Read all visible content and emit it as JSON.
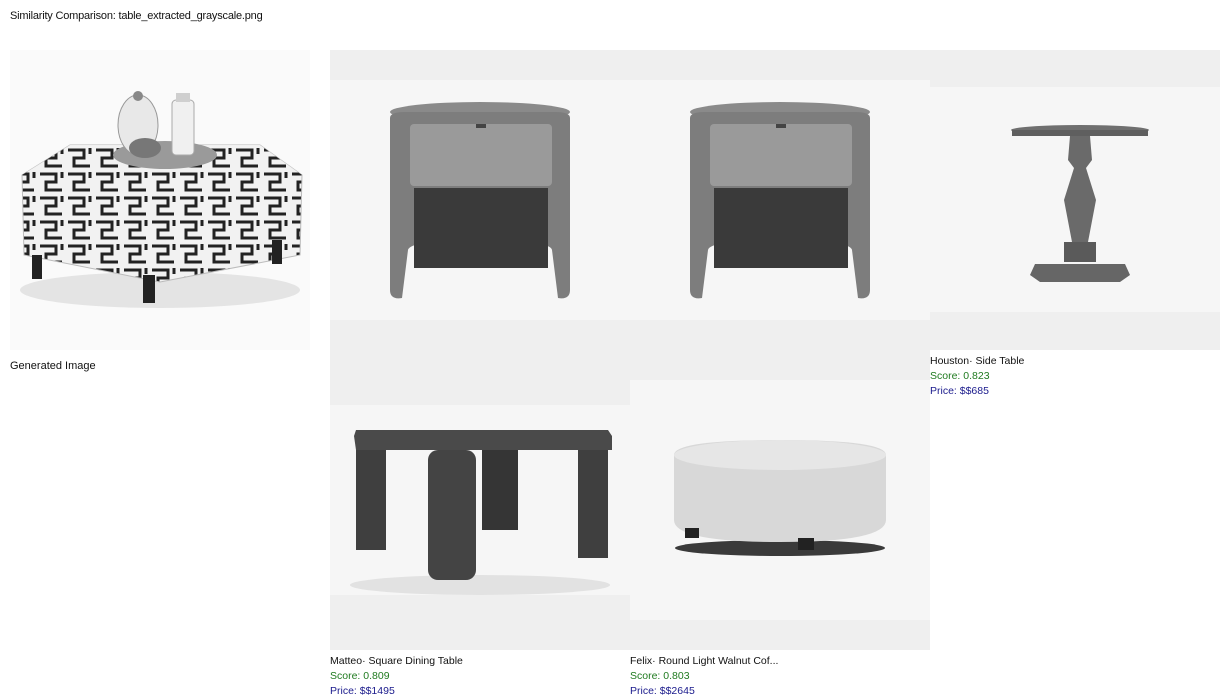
{
  "page": {
    "title": "Similarity Comparison: table_extracted_grayscale.png"
  },
  "generated": {
    "label": "Generated Image",
    "icon": "upholstered-ottoman-with-tray"
  },
  "results": [
    {
      "name": "",
      "score": "",
      "price": "",
      "icon": "round-nightstand"
    },
    {
      "name": "",
      "score": "",
      "price": "",
      "icon": "round-nightstand"
    },
    {
      "name": "Houston· Side Table",
      "score": "Score: 0.823",
      "price": "Price: $$685",
      "icon": "pedestal-side-table"
    },
    {
      "name": "Matteo· Square Dining Table",
      "score": "Score: 0.809",
      "price": "Price: $$1495",
      "icon": "square-dining-table"
    },
    {
      "name": "Felix· Round Light Walnut Cof...",
      "score": "Score: 0.803",
      "price": "Price: $$2645",
      "icon": "round-drum-coffee-table"
    }
  ],
  "colors": {
    "score": "#1f7a1f",
    "price": "#1a1a8c",
    "tile_bg": "#efefef"
  }
}
